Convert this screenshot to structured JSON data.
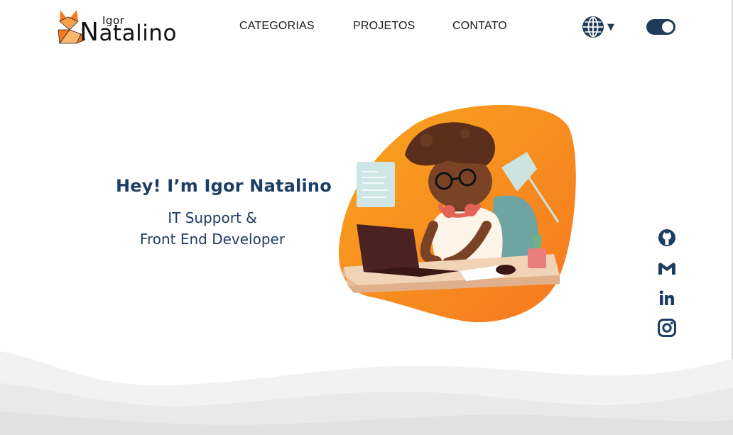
{
  "brand": {
    "small": "Igor",
    "big_first": "N",
    "big_rest": "atalino"
  },
  "nav": {
    "categories": "CATEGORIAS",
    "projects": "PROJETOS",
    "contact": "CONTATO"
  },
  "controls": {
    "language_icon": "globe-icon",
    "language_caret": "▼",
    "theme_toggle": "dark-mode-toggle"
  },
  "hero": {
    "title": "Hey! I’m Igor Natalino",
    "subtitle_line1": "IT Support &",
    "subtitle_line2": "Front End Developer"
  },
  "socials": [
    "github-icon",
    "gmail-icon",
    "linkedin-icon",
    "instagram-icon"
  ],
  "colors": {
    "navy": "#1e3d66",
    "toggle": "#1f3b5a",
    "orange": "#f57c21",
    "wave": "#ececec"
  }
}
